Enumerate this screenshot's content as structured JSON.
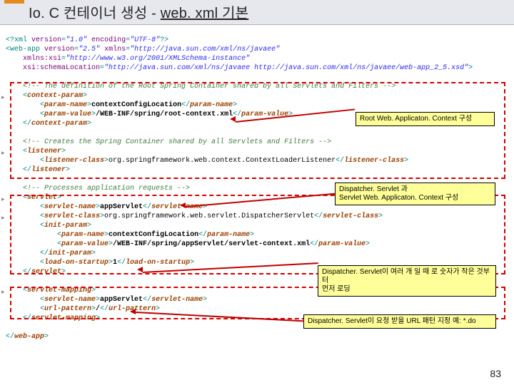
{
  "title": {
    "prefix": "Io. C 컨테이너 생성 - ",
    "underlined": "web. xml 기본"
  },
  "code": {
    "l1_a": "<?xml ",
    "l1_b": "version",
    "l1_c": "=",
    "l1_d": "\"1.0\"",
    "l1_e": " encoding",
    "l1_f": "=",
    "l1_g": "\"UTF-8\"",
    "l1_h": "?>",
    "l2_a": "<web-app ",
    "l2_b": "version",
    "l2_c": "=",
    "l2_d": "\"2.5\"",
    "l2_e": " xmlns",
    "l2_f": "=",
    "l2_g": "\"http://java.sun.com/xml/ns/javaee\"",
    "l3_a": "    xmlns:xsi",
    "l3_b": "=",
    "l3_c": "\"http://www.w3.org/2001/XMLSchema-instance\"",
    "l4_a": "    xsi:schemaLocation",
    "l4_b": "=",
    "l4_c": "\"http://java.sun.com/xml/ns/javaee http://java.sun.com/xml/ns/javaee/web-app_2_5.xsd\"",
    "l4_d": ">",
    "l6": "    <!-- The definition of the Root Spring Container shared by all Servlets and Filters -->",
    "l7_a": "    <",
    "l7_b": "context-param",
    "l7_c": ">",
    "l8_a": "        <",
    "l8_b": "param-name",
    "l8_c": ">",
    "l8_d": "contextConfigLocation",
    "l8_e": "</",
    "l8_f": "param-name",
    "l8_g": ">",
    "l9_a": "        <",
    "l9_b": "param-value",
    "l9_c": ">",
    "l9_d": "/WEB-INF/spring/root-context.xml",
    "l9_e": "</",
    "l9_f": "param-value",
    "l9_g": ">",
    "l10_a": "    </",
    "l10_b": "context-param",
    "l10_c": ">",
    "l12": "    <!-- Creates the Spring Container shared by all Servlets and Filters -->",
    "l13_a": "    <",
    "l13_b": "listener",
    "l13_c": ">",
    "l14_a": "        <",
    "l14_b": "listener-class",
    "l14_c": ">",
    "l14_d": "org.springframework.web.context.ContextLoaderListener",
    "l14_e": "</",
    "l14_f": "listener-class",
    "l14_g": ">",
    "l15_a": "    </",
    "l15_b": "listener",
    "l15_c": ">",
    "l17": "    <!-- Processes application requests -->",
    "l18_a": "    <",
    "l18_b": "servlet",
    "l18_c": ">",
    "l19_a": "        <",
    "l19_b": "servlet-name",
    "l19_c": ">",
    "l19_d": "appServlet",
    "l19_e": "</",
    "l19_f": "servlet-name",
    "l19_g": ">",
    "l20_a": "        <",
    "l20_b": "servlet-class",
    "l20_c": ">",
    "l20_d": "org.springframework.web.servlet.DispatcherServlet",
    "l20_e": "</",
    "l20_f": "servlet-class",
    "l20_g": ">",
    "l21_a": "        <",
    "l21_b": "init-param",
    "l21_c": ">",
    "l22_a": "            <",
    "l22_b": "param-name",
    "l22_c": ">",
    "l22_d": "contextConfigLocation",
    "l22_e": "</",
    "l22_f": "param-name",
    "l22_g": ">",
    "l23_a": "            <",
    "l23_b": "param-value",
    "l23_c": ">",
    "l23_d": "/WEB-INF/spring/appServlet/servlet-context.xml",
    "l23_e": "</",
    "l23_f": "param-value",
    "l23_g": ">",
    "l24_a": "        </",
    "l24_b": "init-param",
    "l24_c": ">",
    "l25_a": "        <",
    "l25_b": "load-on-startup",
    "l25_c": ">",
    "l25_d": "1",
    "l25_e": "</",
    "l25_f": "load-on-startup",
    "l25_g": ">",
    "l26_a": "    </",
    "l26_b": "servlet",
    "l26_c": ">",
    "l28_a": "    <",
    "l28_b": "servlet-mapping",
    "l28_c": ">",
    "l29_a": "        <",
    "l29_b": "servlet-name",
    "l29_c": ">",
    "l29_d": "appServlet",
    "l29_e": "</",
    "l29_f": "servlet-name",
    "l29_g": ">",
    "l30_a": "        <",
    "l30_b": "url-pattern",
    "l30_c": ">",
    "l30_d": "/",
    "l30_e": "</",
    "l30_f": "url-pattern",
    "l30_g": ">",
    "l31_a": "    </",
    "l31_b": "servlet-mapping",
    "l31_c": ">",
    "l33_a": "</",
    "l33_b": "web-app",
    "l33_c": ">"
  },
  "callouts": {
    "c1": "Root Web. Applicaton. Context 구성",
    "c2": "Dispatcher. Servlet 과\nServlet Web. Applicaton. Context 구성",
    "c3": "Dispatcher. Servlet이 여러 개 일 때 로 숫자가 작은 것부터\n먼저 로딩",
    "c4": "Dispatcher. Servlet이 요청 받을 URL 패턴 지정  예:  *.do"
  },
  "pageNumber": "83",
  "tri": "▸"
}
